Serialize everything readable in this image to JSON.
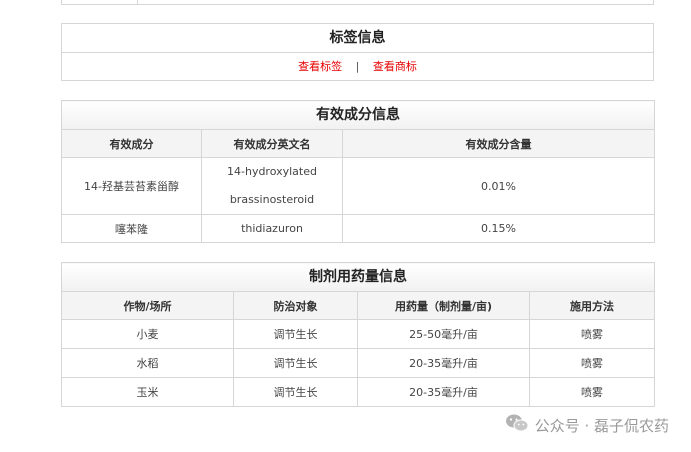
{
  "label_section": {
    "title": "标签信息",
    "view_label": "查看标签",
    "separator": "|",
    "view_trademark": "查看商标"
  },
  "ingredient_section": {
    "title": "有效成分信息",
    "headers": [
      "有效成分",
      "有效成分英文名",
      "有效成分含量"
    ],
    "rows": [
      {
        "name": "14-羟基芸苔素甾醇",
        "en_line1": "14-hydroxylated",
        "en_line2": "brassinosteroid",
        "content": "0.01%"
      },
      {
        "name": "噻苯隆",
        "en_line1": "thidiazuron",
        "en_line2": "",
        "content": "0.15%"
      }
    ]
  },
  "dosage_section": {
    "title": "制剂用药量信息",
    "headers": [
      "作物/场所",
      "防治对象",
      "用药量（制剂量/亩)",
      "施用方法"
    ],
    "rows": [
      {
        "crop": "小麦",
        "target": "调节生长",
        "dose": "25-50毫升/亩",
        "method": "喷雾"
      },
      {
        "crop": "水稻",
        "target": "调节生长",
        "dose": "20-35毫升/亩",
        "method": "喷雾"
      },
      {
        "crop": "玉米",
        "target": "调节生长",
        "dose": "20-35毫升/亩",
        "method": "喷雾"
      }
    ]
  },
  "watermark": {
    "icon": "wechat-icon",
    "text": "公众号 · 磊子侃农药"
  }
}
